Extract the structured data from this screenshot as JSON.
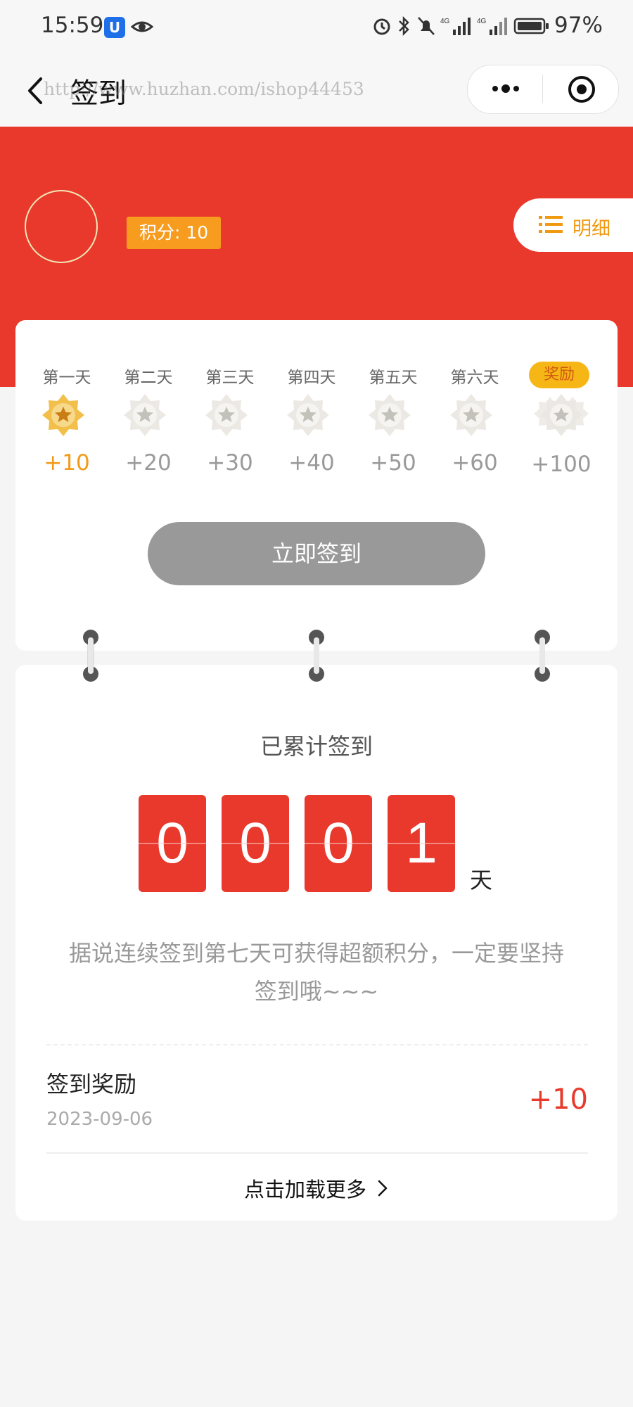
{
  "status_bar": {
    "time": "15:59",
    "battery": "97%"
  },
  "nav": {
    "title": "签到",
    "watermark": "http://www.huzhan.com/ishop44453"
  },
  "header": {
    "points_label": "积分: 10",
    "detail_label": "明细"
  },
  "signin": {
    "days": [
      {
        "label": "第一天",
        "points": "+10",
        "signed": true
      },
      {
        "label": "第二天",
        "points": "+20",
        "signed": false
      },
      {
        "label": "第三天",
        "points": "+30",
        "signed": false
      },
      {
        "label": "第四天",
        "points": "+40",
        "signed": false
      },
      {
        "label": "第五天",
        "points": "+50",
        "signed": false
      },
      {
        "label": "第六天",
        "points": "+60",
        "signed": false
      },
      {
        "label": "奖励",
        "points": "+100",
        "signed": false
      }
    ],
    "button_label": "立即签到"
  },
  "stats": {
    "title": "已累计签到",
    "digits": [
      "0",
      "0",
      "0",
      "1"
    ],
    "unit": "天",
    "tip": "据说连续签到第七天可获得超额积分，一定要坚持签到哦~~~"
  },
  "records": [
    {
      "title": "签到奖励",
      "date": "2023-09-06",
      "points": "+10"
    }
  ],
  "load_more_label": "点击加载更多",
  "colors": {
    "brand_red": "#e8392c",
    "accent_orange": "#f39a16",
    "reward_yellow": "#f6b716",
    "button_gray": "#999999"
  }
}
